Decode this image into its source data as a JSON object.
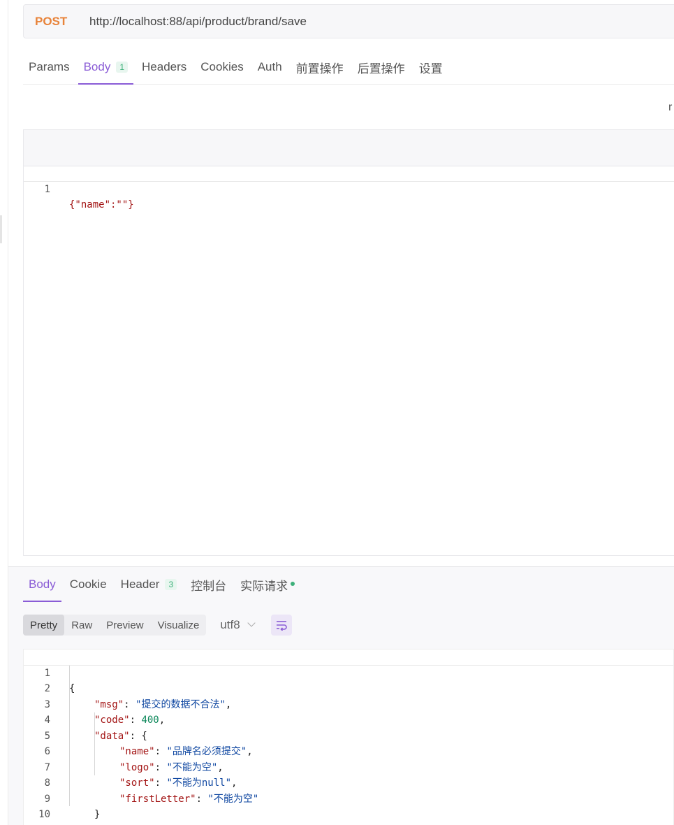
{
  "request": {
    "method": "POST",
    "url": "http://localhost:88/api/product/brand/save",
    "tabs": [
      {
        "label": "Params"
      },
      {
        "label": "Body",
        "badge": "1"
      },
      {
        "label": "Headers"
      },
      {
        "label": "Cookies"
      },
      {
        "label": "Auth"
      },
      {
        "label": "前置操作"
      },
      {
        "label": "后置操作"
      },
      {
        "label": "设置"
      }
    ],
    "right_peek": "r",
    "body_lines": [
      {
        "ln": "1",
        "text": "{\"name\":\"\"}"
      }
    ]
  },
  "response": {
    "tabs": [
      {
        "label": "Body"
      },
      {
        "label": "Cookie"
      },
      {
        "label": "Header",
        "badge": "3"
      },
      {
        "label": "控制台"
      },
      {
        "label": "实际请求"
      }
    ],
    "view_modes": [
      "Pretty",
      "Raw",
      "Preview",
      "Visualize"
    ],
    "encoding": "utf8",
    "lines": {
      "l1": {
        "ln": "1",
        "text": "{"
      },
      "l2": {
        "ln": "2",
        "key": "\"msg\"",
        "sep": ": ",
        "val": "\"提交的数据不合法\"",
        "tail": ","
      },
      "l3": {
        "ln": "3",
        "key": "\"code\"",
        "sep": ": ",
        "val": "400",
        "tail": ","
      },
      "l4": {
        "ln": "4",
        "key": "\"data\"",
        "sep": ": {"
      },
      "l5": {
        "ln": "5",
        "key": "\"name\"",
        "sep": ": ",
        "val": "\"品牌名必须提交\"",
        "tail": ","
      },
      "l6": {
        "ln": "6",
        "key": "\"logo\"",
        "sep": ": ",
        "val": "\"不能为空\"",
        "tail": ","
      },
      "l7": {
        "ln": "7",
        "key": "\"sort\"",
        "sep": ": ",
        "val": "\"不能为null\"",
        "tail": ","
      },
      "l8": {
        "ln": "8",
        "key": "\"firstLetter\"",
        "sep": ": ",
        "val": "\"不能为空\""
      },
      "l9": {
        "ln": "9",
        "text": "}"
      },
      "l10": {
        "ln": "10",
        "text": "}"
      }
    }
  }
}
